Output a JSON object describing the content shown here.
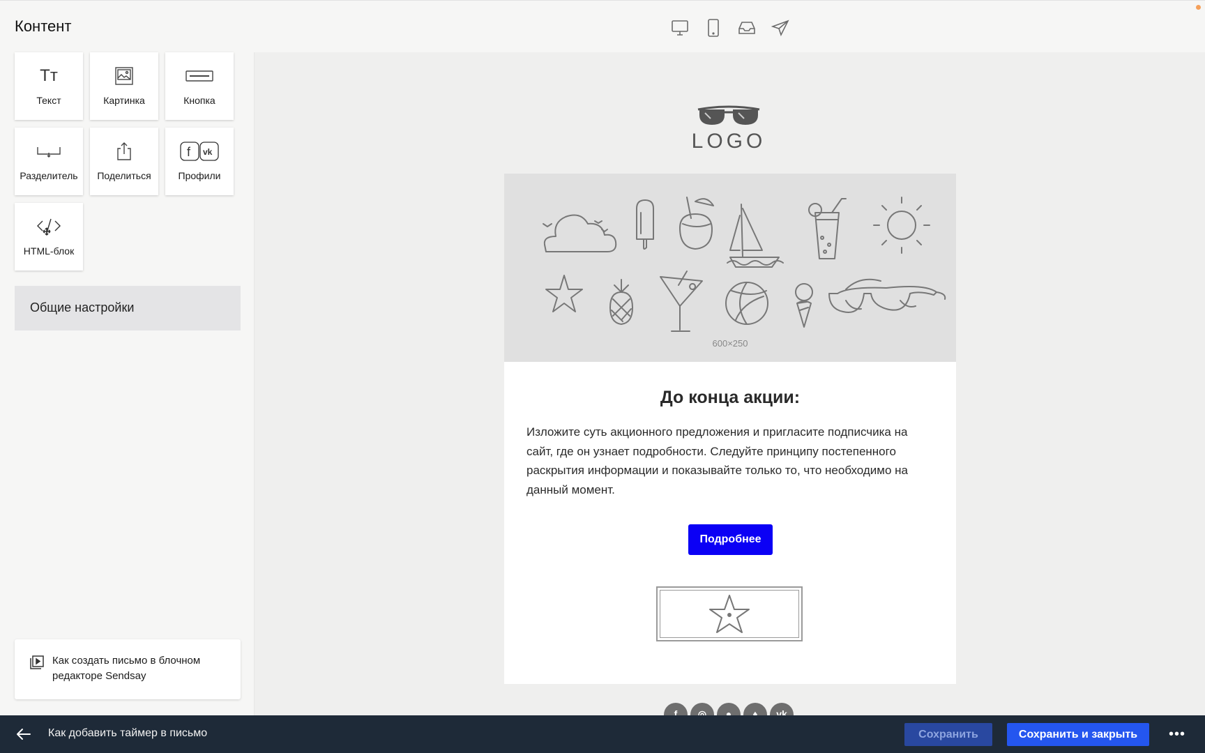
{
  "header": {
    "title": "Контент",
    "view_toggles": [
      {
        "icon": "desktop-icon"
      },
      {
        "icon": "mobile-icon"
      },
      {
        "icon": "inbox-icon"
      },
      {
        "icon": "send-icon"
      }
    ]
  },
  "sidebar": {
    "blocks": [
      {
        "label": "Текст",
        "icon": "text-icon",
        "glyph": "Тт"
      },
      {
        "label": "Картинка",
        "icon": "image-icon"
      },
      {
        "label": "Кнопка",
        "icon": "button-icon"
      },
      {
        "label": "Разделитель",
        "icon": "divider-icon"
      },
      {
        "label": "Поделиться",
        "icon": "share-icon"
      },
      {
        "label": "Профили",
        "icon": "social-profiles-icon"
      },
      {
        "label": "HTML-блок",
        "icon": "code-icon"
      }
    ],
    "general_settings": "Общие настройки",
    "help": {
      "text": "Как создать письмо в блочном редакторе Sendsay",
      "icon": "video-playlist-icon"
    }
  },
  "email": {
    "logo_text": "LOGO",
    "hero_size": "600×250",
    "title": "До конца акции:",
    "body": "Изложите суть акционного предложения и пригласите подписчика на сайт, где он узнает подробности. Следуйте принципу постепенного раскрытия информации и показывайте только то, что необходимо на данный момент.",
    "cta": "Подробнее",
    "cta_color": "#0b00f5",
    "socials": [
      {
        "icon": "facebook-icon",
        "glyph": "f"
      },
      {
        "icon": "instagram-icon",
        "glyph": "◎"
      },
      {
        "icon": "odnoklassniki-icon",
        "glyph": "●"
      },
      {
        "icon": "twitter-icon",
        "glyph": "♦"
      },
      {
        "icon": "vk-icon",
        "glyph": "vk"
      }
    ]
  },
  "footer": {
    "link": "Как добавить таймер в письмо",
    "save": "Сохранить",
    "save_close": "Сохранить и закрыть",
    "more": "•••",
    "save_color": "#2948a0",
    "save_close_color": "#2456ef"
  }
}
